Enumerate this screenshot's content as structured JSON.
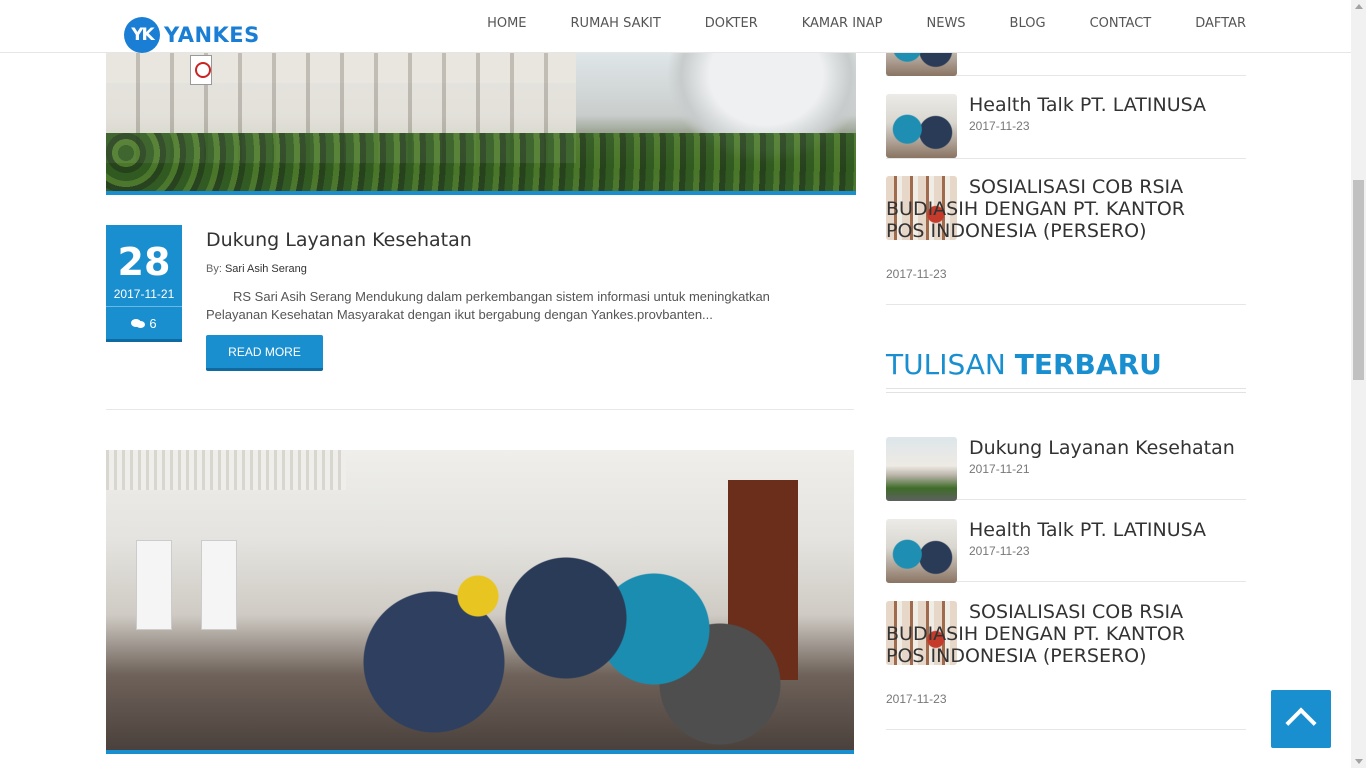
{
  "brand": {
    "badge": "YK",
    "name": "YANKES"
  },
  "nav": {
    "items": [
      "HOME",
      "RUMAH SAKIT",
      "DOKTER",
      "KAMAR INAP",
      "NEWS",
      "BLOG",
      "CONTACT",
      "DAFTAR"
    ]
  },
  "post": {
    "day": "28",
    "date": "2017-11-21",
    "comments": "6",
    "title": "Dukung Layanan Kesehatan",
    "by_label": "By:",
    "author": "Sari Asih Serang",
    "excerpt": "RS Sari Asih Serang Mendukung dalam perkembangan sistem informasi untuk meningkatkan Pelayanan Kesehatan Masyarakat dengan ikut bergabung dengan Yankes.provbanten...",
    "read_more": "READ MORE"
  },
  "sidebar": {
    "popular": [
      {
        "title": "Health Talk PT. LATINUSA",
        "date": "2017-11-23"
      },
      {
        "title": "SOSIALISASI COB RSIA BUDIASIH DENGAN PT. KANTOR POS INDONESIA (PERSERO)",
        "date": "2017-11-23"
      }
    ],
    "latest_heading_light": "TULISAN",
    "latest_heading_bold": "TERBARU",
    "latest": [
      {
        "title": "Dukung Layanan Kesehatan",
        "date": "2017-11-21"
      },
      {
        "title": "Health Talk PT. LATINUSA",
        "date": "2017-11-23"
      },
      {
        "title": "SOSIALISASI COB RSIA BUDIASIH DENGAN PT. KANTOR POS INDONESIA (PERSERO)",
        "date": "2017-11-23"
      }
    ]
  },
  "icons": {
    "comment": "comments-icon",
    "back_to_top": "chevron-up-icon"
  },
  "colors": {
    "accent": "#1a8fd0",
    "brand": "#1a7fd4"
  }
}
